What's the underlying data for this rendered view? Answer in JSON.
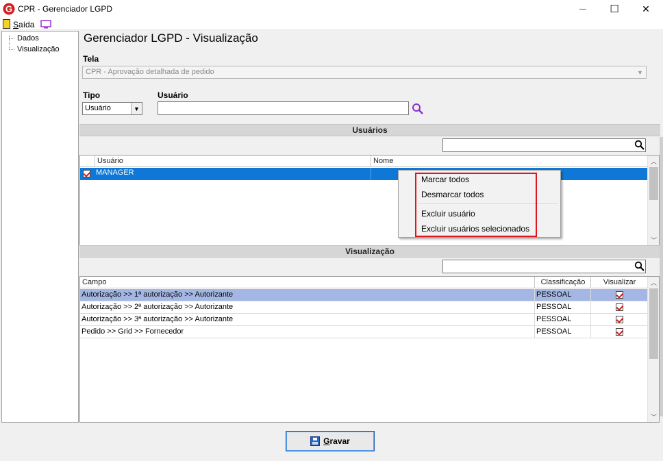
{
  "window": {
    "title": "CPR - Gerenciador LGPD",
    "logo_letter": "G",
    "minimize_glyph": "—",
    "maximize_glyph": "☐",
    "close_glyph": "✕"
  },
  "menu": {
    "exit_label": "Saída",
    "monitor_icon": "monitor-icon"
  },
  "tree": {
    "items": [
      {
        "label": "Dados"
      },
      {
        "label": "Visualização"
      }
    ]
  },
  "main": {
    "title": "Gerenciador LGPD - Visualização",
    "tela_label": "Tela",
    "tela_value": "CPR - Aprovação detalhada de pedido",
    "tipo_label": "Tipo",
    "tipo_value": "Usuário",
    "usuario_label": "Usuário",
    "usuario_value": ""
  },
  "users_section": {
    "header": "Usuários",
    "search_value": "",
    "columns": [
      "Usuário",
      "Nome"
    ],
    "rows": [
      {
        "checked": true,
        "usuario": "MANAGER",
        "nome": ""
      }
    ]
  },
  "context_menu": {
    "items": [
      "Marcar todos",
      "Desmarcar todos",
      "Excluir usuário",
      "Excluir usuários selecionados"
    ]
  },
  "view_section": {
    "header": "Visualização",
    "search_value": "",
    "columns": [
      "Campo",
      "Classificação",
      "Visualizar"
    ],
    "rows": [
      {
        "campo": "Autorização >> 1ª autorização >> Autorizante",
        "classificacao": "PESSOAL",
        "visualizar": true
      },
      {
        "campo": "Autorização >> 2ª autorização >> Autorizante",
        "classificacao": "PESSOAL",
        "visualizar": true
      },
      {
        "campo": "Autorização >> 3ª autorização >> Autorizante",
        "classificacao": "PESSOAL",
        "visualizar": true
      },
      {
        "campo": "Pedido >> Grid >> Fornecedor",
        "classificacao": "PESSOAL",
        "visualizar": true
      }
    ]
  },
  "footer": {
    "save_label": "Gravar"
  },
  "colors": {
    "selected_row_users": "#0f78d7",
    "selected_row_view": "#a4b7e4",
    "highlight_border": "#e0141c",
    "search_icon": "#8b2fc9"
  }
}
